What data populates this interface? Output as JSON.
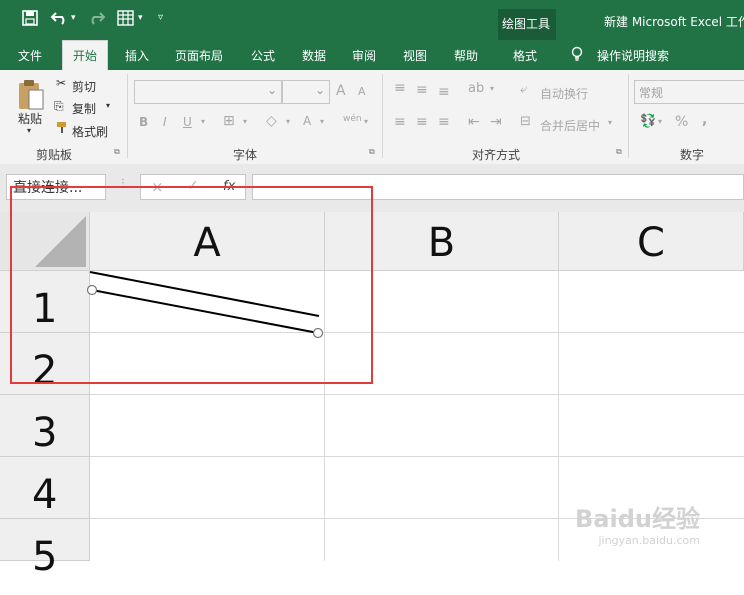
{
  "quick_access": {
    "save": "save-icon",
    "undo": "undo-icon",
    "redo": "redo-icon",
    "table": "table-icon",
    "customize": "customize-icon"
  },
  "title": {
    "context_tab": "绘图工具",
    "window_title": "新建 Microsoft Excel 工作表"
  },
  "tabs": [
    "文件",
    "开始",
    "插入",
    "页面布局",
    "公式",
    "数据",
    "审阅",
    "视图",
    "帮助",
    "格式"
  ],
  "active_tab": "开始",
  "tell_me": "操作说明搜索",
  "clipboard": {
    "paste": "粘贴",
    "cut": "剪切",
    "copy": "复制",
    "format_painter": "格式刷",
    "group": "剪贴板"
  },
  "font": {
    "bold": "B",
    "italic": "I",
    "underline": "U",
    "grow": "A",
    "shrink": "A",
    "color": "A",
    "wen": "wén",
    "group": "字体"
  },
  "alignment": {
    "wrap": "自动换行",
    "merge": "合并后居中",
    "group": "对齐方式"
  },
  "number": {
    "format": "常规",
    "percent": "%",
    "comma": ",",
    "group": "数字"
  },
  "formula_bar": {
    "name_box": "直接连接...",
    "cancel": "×",
    "enter": "✓",
    "fx": "fx"
  },
  "columns": [
    "A",
    "B",
    "C"
  ],
  "rows": [
    "1",
    "2",
    "3",
    "4",
    "5"
  ],
  "watermark": {
    "brand": "Baidu经验",
    "url": "jingyan.baidu.com"
  },
  "colors": {
    "excel_green": "#217346",
    "highlight_red": "#e03c3c"
  }
}
